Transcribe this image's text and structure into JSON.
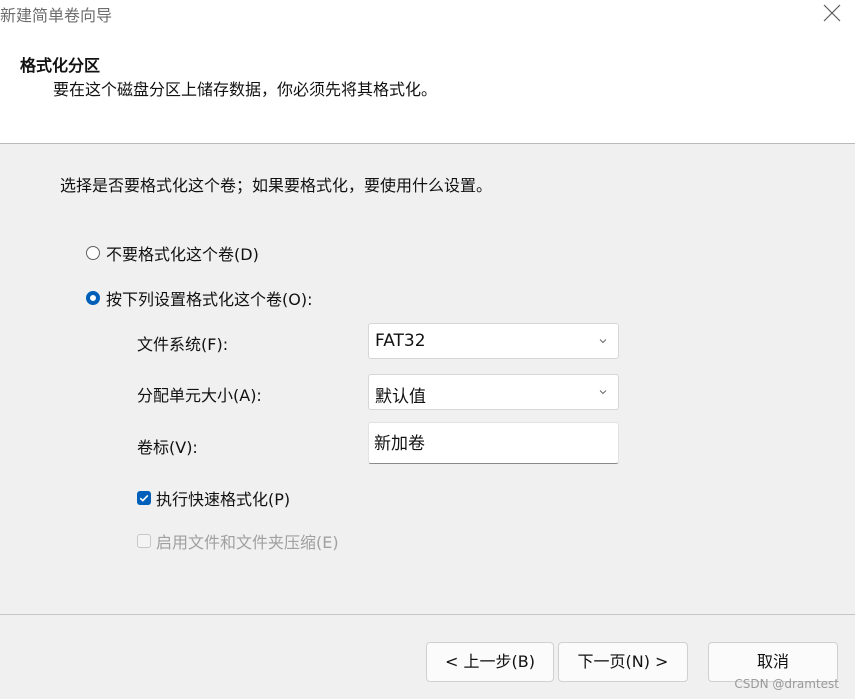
{
  "window": {
    "title": "新建简单卷向导"
  },
  "header": {
    "title": "格式化分区",
    "subtitle": "要在这个磁盘分区上储存数据，你必须先将其格式化。"
  },
  "main": {
    "prompt": "选择是否要格式化这个卷；如果要格式化，要使用什么设置。",
    "options": [
      {
        "label": "不要格式化这个卷(D)",
        "selected": false
      },
      {
        "label": "按下列设置格式化这个卷(O):",
        "selected": true
      }
    ],
    "file_system": {
      "label": "文件系统(F):",
      "value": "FAT32"
    },
    "allocation_unit": {
      "label": "分配单元大小(A):",
      "value": "默认值"
    },
    "volume_label": {
      "label": "卷标(V):",
      "value": "新加卷"
    },
    "quick_format": {
      "label": "执行快速格式化(P)",
      "checked": true
    },
    "compression": {
      "label": "启用文件和文件夹压缩(E)",
      "checked": false,
      "enabled": false
    }
  },
  "footer": {
    "back_label": "< 上一步(B)",
    "next_label": "下一页(N) >",
    "cancel_label": "取消"
  },
  "watermark": "CSDN @dramtest",
  "colors": {
    "accent": "#005fb8",
    "content_bg": "#f0f0f0",
    "header_bg": "#ffffff"
  },
  "icons": {
    "close": "close-icon",
    "dropdown": "chevron-down-icon",
    "check": "checkmark-icon"
  }
}
